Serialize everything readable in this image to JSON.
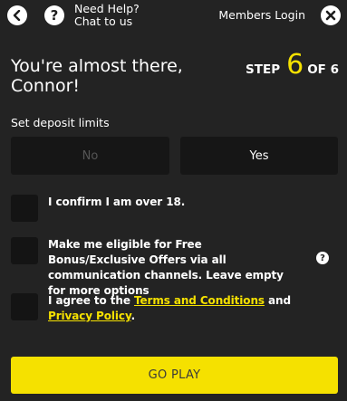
{
  "header": {
    "help_line1": "Need Help?",
    "help_line2": "Chat to us",
    "members_login": "Members Login",
    "help_glyph": "?"
  },
  "intro": {
    "line1": "You're almost there,",
    "line2": "Connor!"
  },
  "step": {
    "prefix": "STEP",
    "current": "6",
    "suffix": "OF 6"
  },
  "deposit": {
    "label": "Set deposit limits",
    "no": "No",
    "yes": "Yes"
  },
  "checks": {
    "age": "I confirm I am over 18.",
    "bonus": "Make me eligible for Free Bonus/Exclusive Offers via all communication channels. Leave empty for more options",
    "info_glyph": "?",
    "terms_pre": "I agree to the ",
    "terms_link": "Terms and Conditions",
    "terms_mid": " and ",
    "privacy_link": "Privacy Policy",
    "terms_post": "."
  },
  "cta": {
    "go_play": "GO PLAY"
  },
  "icons": {
    "back": "back-arrow-icon",
    "help": "help-icon",
    "close": "close-icon",
    "info": "info-icon"
  },
  "colors": {
    "background": "#232323",
    "accent": "#f5e100",
    "input_bg": "#141414"
  }
}
